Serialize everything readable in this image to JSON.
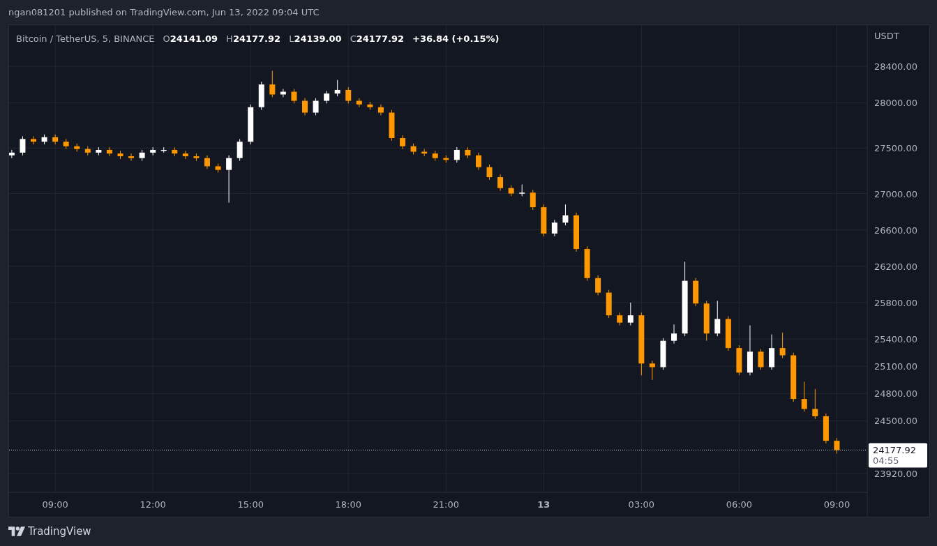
{
  "publisher_line": "ngan081201 published on TradingView.com, Jun 13, 2022 09:04 UTC",
  "legend": {
    "symbol": "Bitcoin / TetherUS, 5, BINANCE",
    "ohlc": [
      {
        "label": "O",
        "value": "24141.09"
      },
      {
        "label": "H",
        "value": "24177.92"
      },
      {
        "label": "L",
        "value": "24139.00"
      },
      {
        "label": "C",
        "value": "24177.92"
      }
    ],
    "change": "+36.84 (+0.15%)"
  },
  "chart": {
    "countdown": "04:55",
    "chart_data": {
      "type": "candlestick",
      "ylabel": "USDT",
      "grid": true,
      "ref_lines": [
        {
          "axis": "y",
          "value": 24177.92,
          "label": "24177.92"
        }
      ],
      "xlim": [
        "2022-06-12T07:35:00Z",
        "2022-06-13T09:56:00Z"
      ],
      "ylim": [
        23713,
        28853
      ],
      "xticks": [
        {
          "value": "2022-06-12T09:00:00Z",
          "label": "09:00"
        },
        {
          "value": "2022-06-12T12:00:00Z",
          "label": "12:00"
        },
        {
          "value": "2022-06-12T15:00:00Z",
          "label": "15:00"
        },
        {
          "value": "2022-06-12T18:00:00Z",
          "label": "18:00"
        },
        {
          "value": "2022-06-12T21:00:00Z",
          "label": "21:00"
        },
        {
          "value": "2022-06-13T00:00:00Z",
          "label": "13"
        },
        {
          "value": "2022-06-13T03:00:00Z",
          "label": "03:00"
        },
        {
          "value": "2022-06-13T06:00:00Z",
          "label": "06:00"
        },
        {
          "value": "2022-06-13T09:00:00Z",
          "label": "09:00"
        }
      ],
      "yticks": [
        {
          "value": 28400,
          "label": "28400.00"
        },
        {
          "value": 28000,
          "label": "28000.00"
        },
        {
          "value": 27500,
          "label": "27500.00"
        },
        {
          "value": 27000,
          "label": "27000.00"
        },
        {
          "value": 26600,
          "label": "26600.00"
        },
        {
          "value": 26200,
          "label": "26200.00"
        },
        {
          "value": 25800,
          "label": "25800.00"
        },
        {
          "value": 25400,
          "label": "25400.00"
        },
        {
          "value": 25100,
          "label": "25100.00"
        },
        {
          "value": 24800,
          "label": "24800.00"
        },
        {
          "value": 24500,
          "label": "24500.00"
        },
        {
          "value": 23920,
          "label": "23920.00"
        }
      ],
      "x": [
        "2022-06-12T07:40:00Z",
        "2022-06-12T08:00:00Z",
        "2022-06-12T08:20:00Z",
        "2022-06-12T08:40:00Z",
        "2022-06-12T09:00:00Z",
        "2022-06-12T09:20:00Z",
        "2022-06-12T09:40:00Z",
        "2022-06-12T10:00:00Z",
        "2022-06-12T10:20:00Z",
        "2022-06-12T10:40:00Z",
        "2022-06-12T11:00:00Z",
        "2022-06-12T11:20:00Z",
        "2022-06-12T11:40:00Z",
        "2022-06-12T12:00:00Z",
        "2022-06-12T12:20:00Z",
        "2022-06-12T12:40:00Z",
        "2022-06-12T13:00:00Z",
        "2022-06-12T13:20:00Z",
        "2022-06-12T13:40:00Z",
        "2022-06-12T14:00:00Z",
        "2022-06-12T14:20:00Z",
        "2022-06-12T14:40:00Z",
        "2022-06-12T15:00:00Z",
        "2022-06-12T15:20:00Z",
        "2022-06-12T15:40:00Z",
        "2022-06-12T16:00:00Z",
        "2022-06-12T16:20:00Z",
        "2022-06-12T16:40:00Z",
        "2022-06-12T17:00:00Z",
        "2022-06-12T17:20:00Z",
        "2022-06-12T17:40:00Z",
        "2022-06-12T18:00:00Z",
        "2022-06-12T18:20:00Z",
        "2022-06-12T18:40:00Z",
        "2022-06-12T19:00:00Z",
        "2022-06-12T19:20:00Z",
        "2022-06-12T19:40:00Z",
        "2022-06-12T20:00:00Z",
        "2022-06-12T20:20:00Z",
        "2022-06-12T20:40:00Z",
        "2022-06-12T21:00:00Z",
        "2022-06-12T21:20:00Z",
        "2022-06-12T21:40:00Z",
        "2022-06-12T22:00:00Z",
        "2022-06-12T22:20:00Z",
        "2022-06-12T22:40:00Z",
        "2022-06-12T23:00:00Z",
        "2022-06-12T23:20:00Z",
        "2022-06-12T23:40:00Z",
        "2022-06-13T00:00:00Z",
        "2022-06-13T00:20:00Z",
        "2022-06-13T00:40:00Z",
        "2022-06-13T01:00:00Z",
        "2022-06-13T01:20:00Z",
        "2022-06-13T01:40:00Z",
        "2022-06-13T02:00:00Z",
        "2022-06-13T02:20:00Z",
        "2022-06-13T02:40:00Z",
        "2022-06-13T03:00:00Z",
        "2022-06-13T03:20:00Z",
        "2022-06-13T03:40:00Z",
        "2022-06-13T04:00:00Z",
        "2022-06-13T04:20:00Z",
        "2022-06-13T04:40:00Z",
        "2022-06-13T05:00:00Z",
        "2022-06-13T05:20:00Z",
        "2022-06-13T05:40:00Z",
        "2022-06-13T06:00:00Z",
        "2022-06-13T06:20:00Z",
        "2022-06-13T06:40:00Z",
        "2022-06-13T07:00:00Z",
        "2022-06-13T07:20:00Z",
        "2022-06-13T07:40:00Z",
        "2022-06-13T08:00:00Z",
        "2022-06-13T08:20:00Z",
        "2022-06-13T08:40:00Z",
        "2022-06-13T09:00:00Z"
      ],
      "ohlc": [
        [
          27420,
          27480,
          27390,
          27450
        ],
        [
          27450,
          27630,
          27420,
          27600
        ],
        [
          27600,
          27630,
          27540,
          27570
        ],
        [
          27570,
          27650,
          27540,
          27620
        ],
        [
          27620,
          27650,
          27540,
          27570
        ],
        [
          27570,
          27600,
          27490,
          27520
        ],
        [
          27520,
          27550,
          27460,
          27490
        ],
        [
          27490,
          27520,
          27420,
          27450
        ],
        [
          27450,
          27510,
          27420,
          27480
        ],
        [
          27480,
          27510,
          27410,
          27440
        ],
        [
          27440,
          27470,
          27380,
          27410
        ],
        [
          27410,
          27440,
          27360,
          27390
        ],
        [
          27390,
          27480,
          27360,
          27450
        ],
        [
          27450,
          27510,
          27420,
          27480
        ],
        [
          27480,
          27510,
          27450,
          27480
        ],
        [
          27480,
          27510,
          27410,
          27440
        ],
        [
          27440,
          27470,
          27380,
          27410
        ],
        [
          27410,
          27440,
          27360,
          27390
        ],
        [
          27390,
          27420,
          27270,
          27300
        ],
        [
          27300,
          27330,
          27230,
          27260
        ],
        [
          27260,
          27420,
          26900,
          27390
        ],
        [
          27390,
          27600,
          27360,
          27570
        ],
        [
          27570,
          27980,
          27540,
          27950
        ],
        [
          27950,
          28230,
          27920,
          28200
        ],
        [
          28200,
          28350,
          28060,
          28090
        ],
        [
          28090,
          28150,
          28060,
          28120
        ],
        [
          28120,
          28150,
          27990,
          28020
        ],
        [
          28020,
          28050,
          27860,
          27890
        ],
        [
          27890,
          28050,
          27860,
          28020
        ],
        [
          28020,
          28130,
          27990,
          28100
        ],
        [
          28100,
          28250,
          28070,
          28140
        ],
        [
          28140,
          28170,
          27990,
          28020
        ],
        [
          28020,
          28050,
          27950,
          27980
        ],
        [
          27980,
          28010,
          27920,
          27950
        ],
        [
          27950,
          27980,
          27860,
          27890
        ],
        [
          27890,
          27920,
          27580,
          27610
        ],
        [
          27610,
          27640,
          27490,
          27520
        ],
        [
          27520,
          27550,
          27430,
          27460
        ],
        [
          27460,
          27490,
          27410,
          27440
        ],
        [
          27440,
          27470,
          27360,
          27390
        ],
        [
          27390,
          27420,
          27340,
          27370
        ],
        [
          27370,
          27510,
          27340,
          27480
        ],
        [
          27480,
          27510,
          27390,
          27420
        ],
        [
          27420,
          27450,
          27260,
          27290
        ],
        [
          27290,
          27320,
          27150,
          27180
        ],
        [
          27180,
          27210,
          27030,
          27060
        ],
        [
          27060,
          27090,
          26970,
          27000
        ],
        [
          27000,
          27100,
          26970,
          27010
        ],
        [
          27010,
          27040,
          26820,
          26850
        ],
        [
          26850,
          26880,
          26530,
          26560
        ],
        [
          26560,
          26710,
          26530,
          26680
        ],
        [
          26680,
          26880,
          26650,
          26760
        ],
        [
          26760,
          26790,
          26360,
          26390
        ],
        [
          26390,
          26420,
          26040,
          26070
        ],
        [
          26070,
          26100,
          25880,
          25910
        ],
        [
          25910,
          25940,
          25630,
          25660
        ],
        [
          25660,
          25690,
          25550,
          25580
        ],
        [
          25580,
          25800,
          25550,
          25660
        ],
        [
          25660,
          25690,
          25000,
          25130
        ],
        [
          25130,
          25160,
          24950,
          25090
        ],
        [
          25090,
          25410,
          25060,
          25380
        ],
        [
          25380,
          25560,
          25350,
          25460
        ],
        [
          25460,
          26250,
          25430,
          26040
        ],
        [
          26040,
          26070,
          25760,
          25790
        ],
        [
          25790,
          25820,
          25380,
          25460
        ],
        [
          25460,
          25820,
          25430,
          25620
        ],
        [
          25620,
          25650,
          25270,
          25300
        ],
        [
          25300,
          25330,
          25000,
          25030
        ],
        [
          25030,
          25550,
          25000,
          25260
        ],
        [
          25260,
          25290,
          25060,
          25090
        ],
        [
          25090,
          25450,
          25060,
          25300
        ],
        [
          25300,
          25470,
          25190,
          25220
        ],
        [
          25220,
          25250,
          24710,
          24740
        ],
        [
          24740,
          24930,
          24600,
          24630
        ],
        [
          24630,
          24850,
          24520,
          24550
        ],
        [
          24550,
          24580,
          24250,
          24280
        ],
        [
          24280,
          24310,
          24139,
          24177.92
        ]
      ]
    }
  },
  "footer": {
    "brand": "TradingView"
  }
}
